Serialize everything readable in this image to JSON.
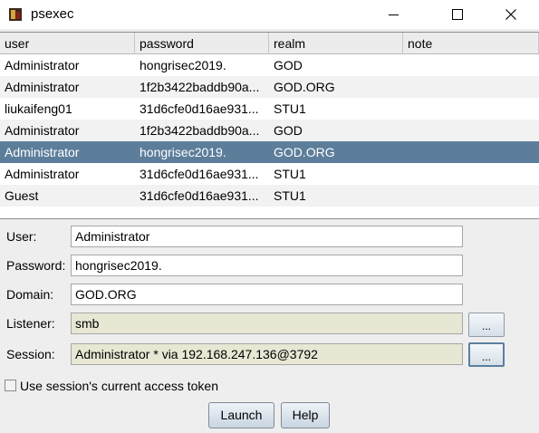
{
  "window": {
    "title": "psexec"
  },
  "table": {
    "columns": [
      "user",
      "password",
      "realm",
      "note"
    ],
    "rows": [
      {
        "user": "Administrator",
        "password": "hongrisec2019.",
        "realm": "GOD",
        "note": ""
      },
      {
        "user": "Administrator",
        "password": "1f2b3422baddb90a...",
        "realm": "GOD.ORG",
        "note": ""
      },
      {
        "user": "liukaifeng01",
        "password": "31d6cfe0d16ae931...",
        "realm": "STU1",
        "note": ""
      },
      {
        "user": "Administrator",
        "password": "1f2b3422baddb90a...",
        "realm": "GOD",
        "note": ""
      },
      {
        "user": "Administrator",
        "password": "hongrisec2019.",
        "realm": "GOD.ORG",
        "note": ""
      },
      {
        "user": "Administrator",
        "password": "31d6cfe0d16ae931...",
        "realm": "STU1",
        "note": ""
      },
      {
        "user": "Guest",
        "password": "31d6cfe0d16ae931...",
        "realm": "STU1",
        "note": ""
      }
    ],
    "selected_row": 4
  },
  "form": {
    "user_label": "User:",
    "user_value": "Administrator",
    "password_label": "Password:",
    "password_value": "hongrisec2019.",
    "domain_label": "Domain:",
    "domain_value": "GOD.ORG",
    "listener_label": "Listener:",
    "listener_value": "smb",
    "session_label": "Session:",
    "session_value": "Administrator * via  192.168.247.136@3792",
    "browse_label": "...",
    "token_checkbox_label": "Use session's current access token",
    "token_checked": false
  },
  "buttons": {
    "launch": "Launch",
    "help": "Help"
  },
  "icons": {
    "app": "psexec-app-icon",
    "minimize": "minimize-icon",
    "maximize": "maximize-icon",
    "close": "close-icon"
  }
}
